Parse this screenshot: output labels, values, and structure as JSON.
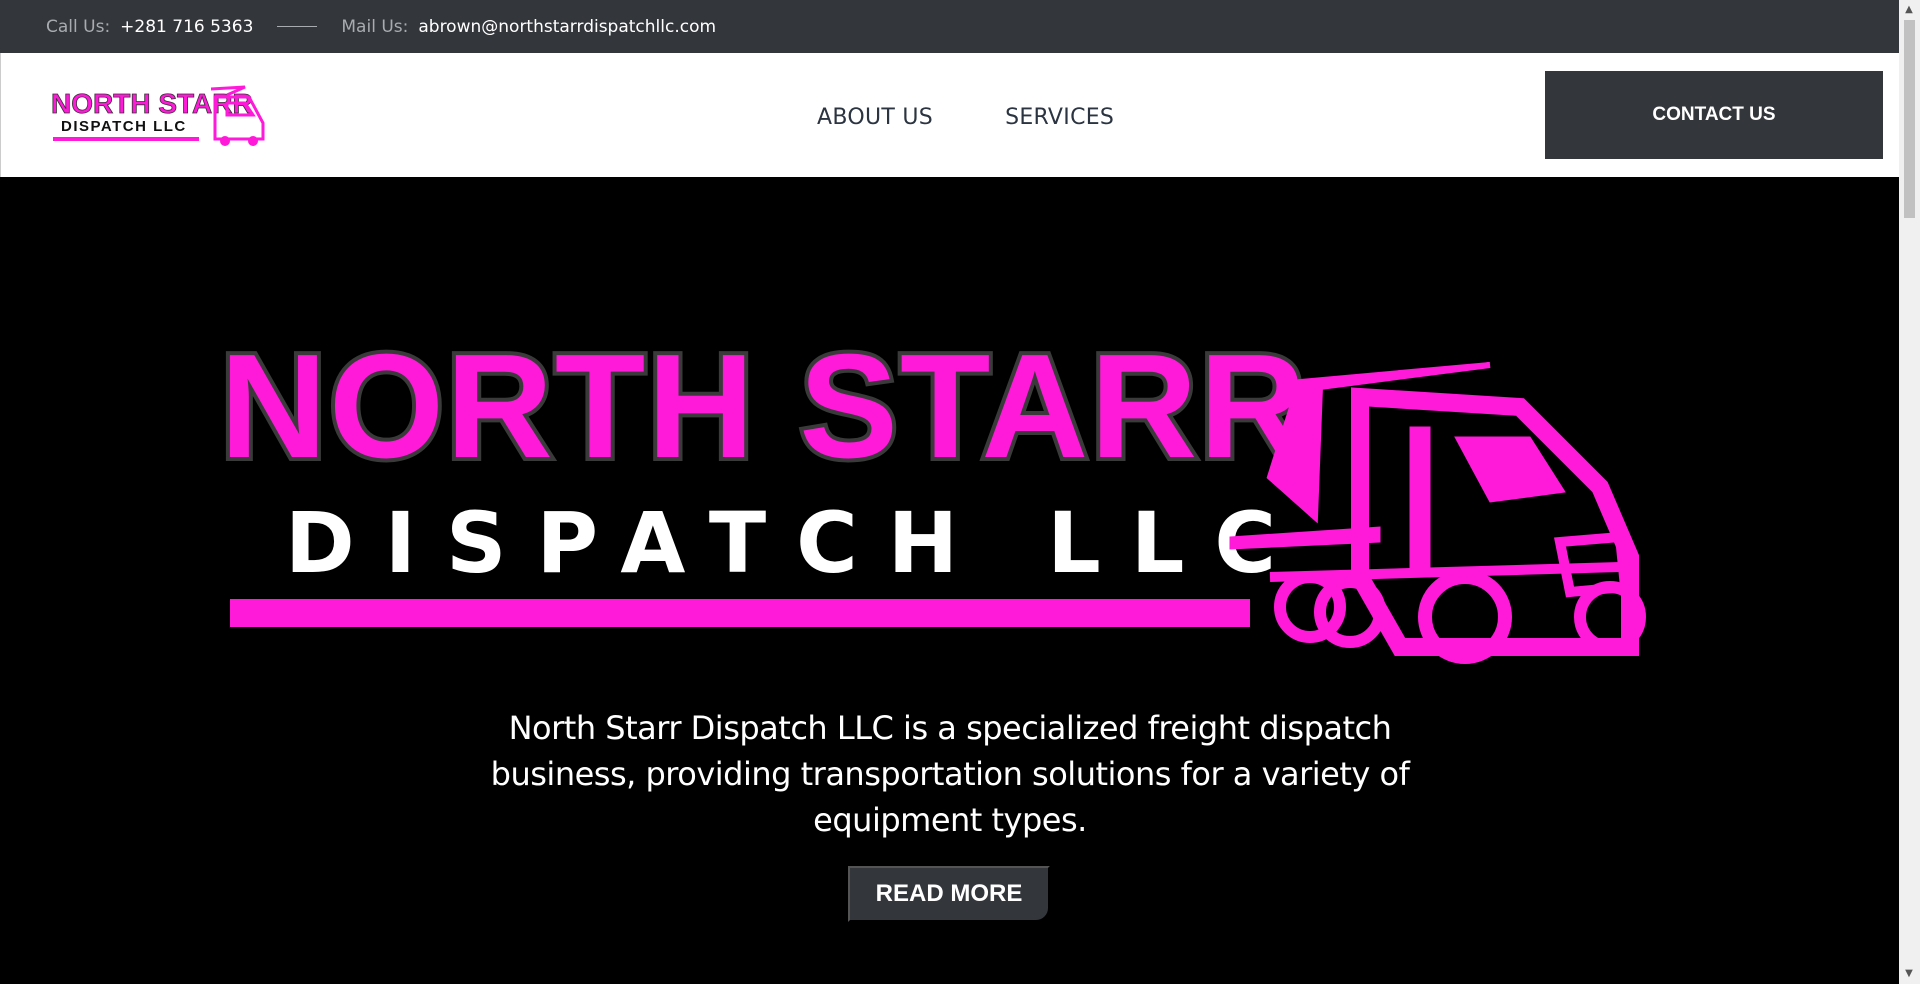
{
  "topbar": {
    "call_label": "Call Us:",
    "phone": "+281 716 5363",
    "mail_label": "Mail Us:",
    "email": "abrown@northstarrdispatchllc.com"
  },
  "header": {
    "logo": {
      "line1": "NORTH STARR",
      "line2": "DISPATCH LLC"
    },
    "nav": [
      "ABOUT US",
      "SERVICES"
    ],
    "contact_label": "CONTACT US"
  },
  "hero": {
    "logo": {
      "line1": "NORTH STARR",
      "line2": "DISPATCH LLC"
    },
    "description_lines": [
      "North Starr Dispatch LLC is a specialized freight dispatch",
      "business, providing transportation solutions for a variety of",
      "equipment types."
    ],
    "button_label": "READ MORE"
  },
  "colors": {
    "brand_magenta": "#ff1ad9",
    "dark": "#33363b",
    "background": "#000000"
  }
}
